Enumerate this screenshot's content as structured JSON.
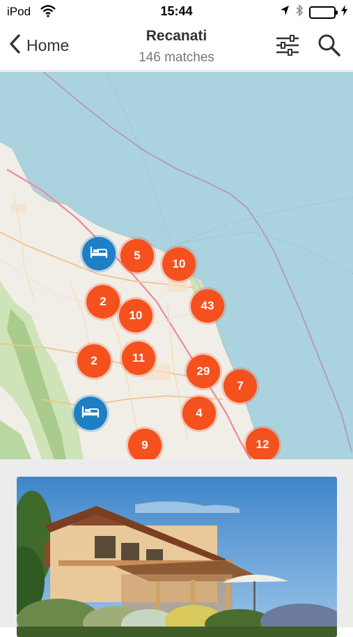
{
  "status": {
    "carrier": "iPod",
    "time": "15:44",
    "battery_level": 1.0,
    "battery_color": "#4cd964"
  },
  "nav": {
    "back_label": "Home",
    "title": "Recanati",
    "subtitle": "146 matches",
    "icons": [
      "chevron-left-icon",
      "filter-sliders-icon",
      "search-icon"
    ]
  },
  "map": {
    "sea_color": "#aad3df",
    "land_color": "#f1eee8",
    "accent_cluster": "#f4511e",
    "accent_pin": "#1f7fc4",
    "clusters": [
      {
        "count": "5"
      },
      {
        "count": "10"
      },
      {
        "count": "2"
      },
      {
        "count": "10"
      },
      {
        "count": "43"
      },
      {
        "count": "2"
      },
      {
        "count": "11"
      },
      {
        "count": "29"
      },
      {
        "count": "7"
      },
      {
        "count": "4"
      },
      {
        "count": "9"
      },
      {
        "count": "12"
      }
    ],
    "hotel_pins": [
      "hotel-bed-icon",
      "hotel-bed-icon"
    ]
  },
  "listing": {
    "card_image": "villa-photo"
  }
}
